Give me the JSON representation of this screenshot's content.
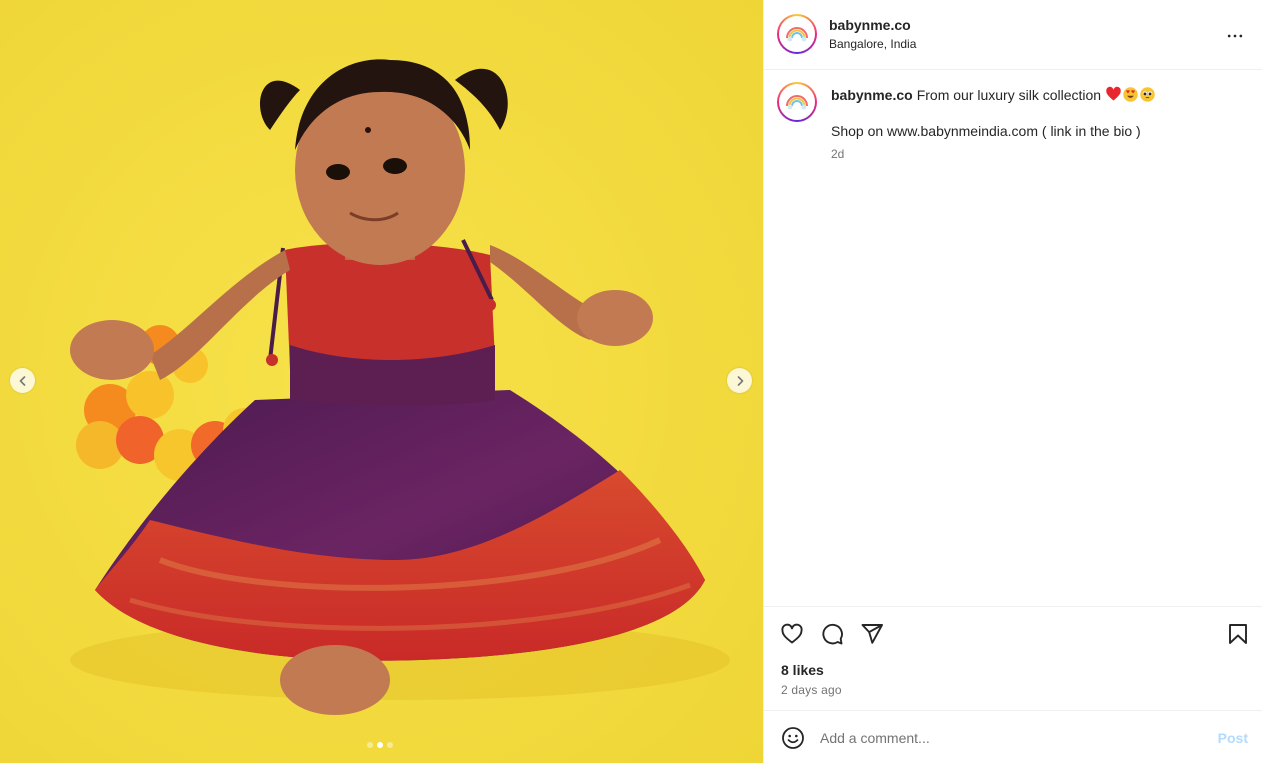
{
  "post": {
    "media": {
      "alt": "",
      "slide_count": 3,
      "active_slide": 2,
      "background_color": "#f2da3c"
    },
    "author": {
      "username": "babynme.co",
      "location": "Bangalore, India"
    },
    "caption": {
      "username": "babynme.co",
      "text": "From our luxury silk collection",
      "emojis": [
        "red-heart",
        "heart-eyes-face",
        "pleading-face"
      ],
      "line2": "Shop on www.babynmeindia.com ( link in the bio )",
      "time_short": "2d"
    },
    "actions": {
      "like_icon": "heart-icon",
      "comment_icon": "comment-icon",
      "share_icon": "send-icon",
      "save_icon": "bookmark-icon"
    },
    "likes": "8 likes",
    "time_long": "2 days ago",
    "add_comment": {
      "placeholder": "Add a comment...",
      "post_label": "Post"
    }
  },
  "colors": {
    "accent_disabled": "#b3dbff",
    "secondary_text": "#737373",
    "border": "#efefef"
  }
}
